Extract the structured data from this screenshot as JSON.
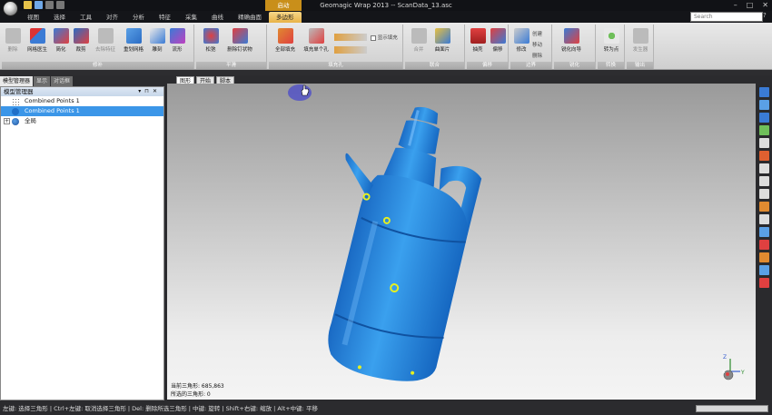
{
  "window": {
    "title": "Geomagic Wrap 2013 -- ScanData_13.asc",
    "context_group": "启动",
    "min": "–",
    "max": "□",
    "close": "✕"
  },
  "tabs": [
    "视图",
    "选择",
    "工具",
    "对齐",
    "分析",
    "特征",
    "采集",
    "曲线",
    "精确曲面",
    "多边形"
  ],
  "active_tab": "多边形",
  "search": {
    "placeholder": "Search",
    "help": "?"
  },
  "ribbon": {
    "groups": [
      {
        "label": "修补",
        "buttons": [
          "删除",
          "网格医生",
          "简化",
          "裁剪",
          "去除特征",
          "重划网格",
          "雕刻",
          "流形"
        ]
      },
      {
        "label": "平滑",
        "buttons": [
          "松弛",
          "删除钉状物"
        ]
      },
      {
        "label": "填充孔",
        "buttons": [
          "全部填充",
          "填充单个孔"
        ],
        "extra": "显示填充"
      },
      {
        "label": "联合",
        "buttons": [
          "合并",
          "曲面片"
        ]
      },
      {
        "label": "偏移",
        "buttons": [
          "抽壳",
          "偏移"
        ]
      },
      {
        "label": "边界",
        "buttons": [
          "修改"
        ],
        "extras": [
          "创建",
          "移动",
          "删除"
        ]
      },
      {
        "label": "锐化",
        "buttons": [
          "锐化向导"
        ]
      },
      {
        "label": "转换",
        "buttons": [
          "转为点"
        ]
      },
      {
        "label": "输出",
        "buttons": [
          "发生器"
        ]
      }
    ]
  },
  "left_tabs": [
    "模型管理器",
    "显示",
    "对话框"
  ],
  "panel": {
    "title": "模型管理器",
    "items": [
      {
        "label": "Combined Points 1",
        "selected": false
      },
      {
        "label": "Combined Points 1",
        "selected": true
      },
      {
        "label": "全局",
        "selected": false
      }
    ]
  },
  "viewport_tabs": [
    "图形",
    "开始",
    "脚本"
  ],
  "stats": {
    "current": "当前三角形: 685,863",
    "selected": "所选的三角形: 0"
  },
  "axis": {
    "x": "X",
    "y": "Y",
    "z": "Z"
  },
  "statusbar": "左键: 选择三角形 | Ctrl+左键: 取消选择三角形 | Del: 删除所选三角形 | 中键: 旋转 | Shift+右键: 缩放 | Alt+中键: 平移",
  "colors": {
    "model": "#2f8fe0",
    "selection": "#3b96e8",
    "tab_active": "#e8b247"
  }
}
